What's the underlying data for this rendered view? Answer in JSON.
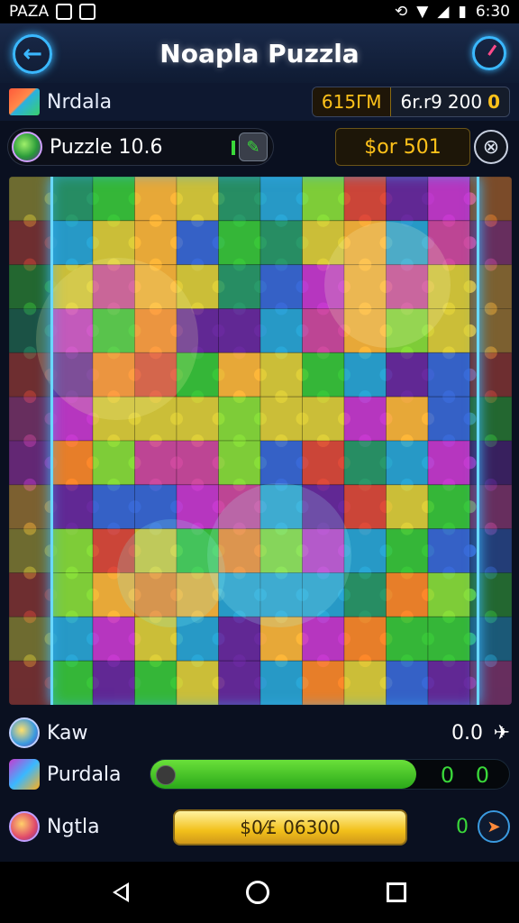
{
  "status_bar": {
    "carrier": "PAZA"
  },
  "header": {
    "title": "Noapla Puzzla"
  },
  "info_bar": {
    "name": "Nrdala",
    "stat_a": "615ΓM",
    "stat_b": "6r.r9",
    "stat_c": "200",
    "stat_c_suffix": "0"
  },
  "level_bar": {
    "label": "Puzzle 10.6",
    "score": "$or 501"
  },
  "rows": {
    "kaw": {
      "label": "Kaw",
      "value": "0.0"
    },
    "purdala": {
      "label": "Purdala",
      "value": "0 0",
      "progress": 0.74
    },
    "ngtla": {
      "label": "Ngtla",
      "button": "$0⁄£ 06300",
      "value": "0"
    }
  },
  "colors": {
    "accent_blue": "#3ab8ff",
    "gold": "#ffc21a",
    "green": "#3ad83a"
  }
}
